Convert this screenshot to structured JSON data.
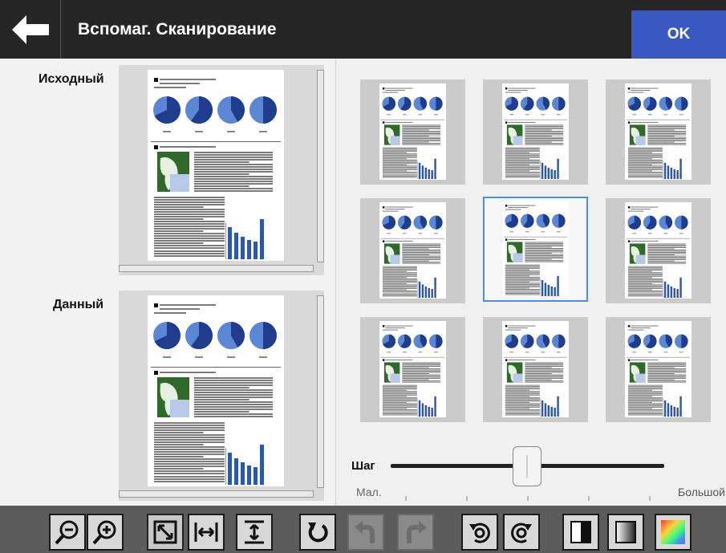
{
  "header": {
    "title": "Вспомаг. Сканирование",
    "ok_label": "OK",
    "back_icon": "arrow-left-icon"
  },
  "left": {
    "original_label": "Исходный",
    "current_label": "Данный"
  },
  "thumbnails": {
    "count": 9,
    "selected_index": 4
  },
  "slider": {
    "label": "Шаг",
    "min_label": "Мал.",
    "max_label": "Большой",
    "value_fraction": 0.5
  },
  "toolbar": {
    "buttons": [
      {
        "name": "zoom-out-icon"
      },
      {
        "name": "zoom-in-icon"
      },
      {
        "name": "fit-page-icon"
      },
      {
        "name": "fit-width-icon"
      },
      {
        "name": "fit-height-icon"
      },
      {
        "name": "rotate-icon"
      },
      {
        "name": "rotate-left-disabled-icon"
      },
      {
        "name": "rotate-right-disabled-icon"
      },
      {
        "name": "undo-rotate-icon"
      },
      {
        "name": "redo-rotate-icon"
      },
      {
        "name": "bw-mode-icon"
      },
      {
        "name": "grayscale-mode-icon"
      },
      {
        "name": "color-mode-icon"
      }
    ]
  },
  "colors": {
    "header_bg": "#262626",
    "ok_bg": "#3a58c4",
    "selection": "#4a90e2",
    "pie_dark": "#1f3d8c",
    "pie_light": "#5b86d6"
  }
}
